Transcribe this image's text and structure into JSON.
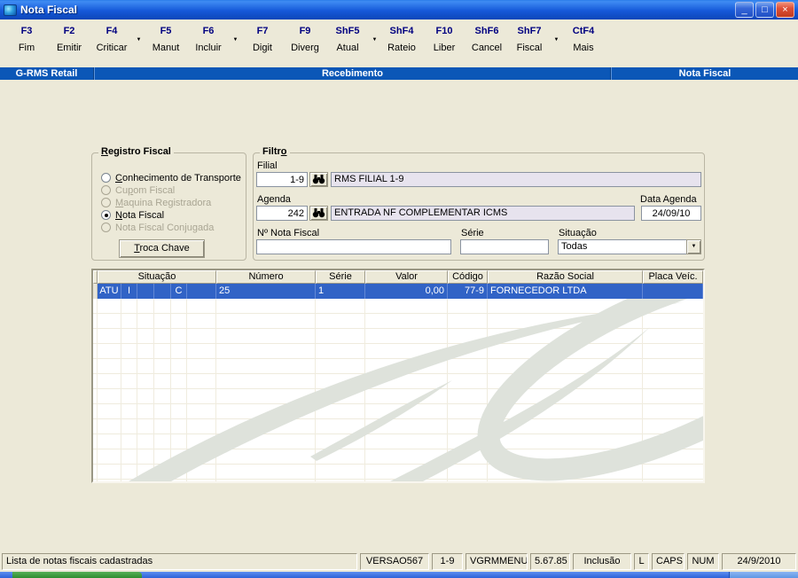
{
  "window": {
    "title": "Nota Fiscal"
  },
  "window_controls": {
    "minimize": "_",
    "restore": "□",
    "close": "×"
  },
  "icons": {
    "dropdown_arrow": "▼"
  },
  "colors": {
    "banner_blue": "#0B57B7",
    "selection_blue": "#3163C6",
    "toolbar_key_navy": "#000080",
    "readonly_field_lavender": "#E7E3EE",
    "watermark_gray": "#DEE2DB",
    "desktop_beige": "#ECE9D8"
  },
  "toolbar": {
    "buttons": [
      {
        "key": "F3",
        "label": "Fim"
      },
      {
        "key": "F2",
        "label": "Emitir"
      },
      {
        "key": "F4",
        "label": "Criticar"
      },
      {
        "key": "F5",
        "label": "Manut"
      },
      {
        "key": "F6",
        "label": "Incluir"
      },
      {
        "key": "F7",
        "label": "Digit"
      },
      {
        "key": "F9",
        "label": "Diverg"
      },
      {
        "key": "ShF5",
        "label": "Atual"
      },
      {
        "key": "ShF4",
        "label": "Rateio"
      },
      {
        "key": "F10",
        "label": "Liber"
      },
      {
        "key": "ShF6",
        "label": "Cancel"
      },
      {
        "key": "ShF7",
        "label": "Fiscal"
      },
      {
        "key": "CtF4",
        "label": "Mais"
      }
    ]
  },
  "banner": {
    "left": "G-RMS Retail",
    "center": "Recebimento",
    "right": "Nota Fiscal"
  },
  "registro": {
    "title": "&Registro Fiscal",
    "options": [
      {
        "label": "&Conhecimento de Transporte",
        "selected": false,
        "disabled": false
      },
      {
        "label": "Cu&pom Fiscal",
        "selected": false,
        "disabled": true
      },
      {
        "label": "&Maquina Registradora",
        "selected": false,
        "disabled": true
      },
      {
        "label": "&Nota Fiscal",
        "selected": true,
        "disabled": false
      },
      {
        "label": "Nota Fiscal Con&jugada",
        "selected": false,
        "disabled": true
      }
    ],
    "button_label": "&Troca Chave"
  },
  "filtro": {
    "title": "Filtr&o",
    "filial": {
      "label": "Filial",
      "code": "1-9",
      "name": "RMS FILIAL 1-9"
    },
    "agenda": {
      "label": "Agenda",
      "code": "242",
      "name": "ENTRADA NF COMPLEMENTAR ICMS"
    },
    "data_agenda": {
      "label": "Data Agenda",
      "value": "24/09/10"
    },
    "nota_fiscal": {
      "label": "Nº Nota Fiscal",
      "value": ""
    },
    "serie": {
      "label": "Série",
      "value": ""
    },
    "situacao": {
      "label": "Situação",
      "value": "Todas"
    }
  },
  "table": {
    "group_header": "Situação",
    "headers": [
      "Número",
      "Série",
      "Valor",
      "Código",
      "Razão Social",
      "Placa Veíc."
    ],
    "row": {
      "situacao": [
        "ATU",
        "I",
        "",
        "",
        "C",
        ""
      ],
      "numero": "25",
      "serie": "1",
      "valor": "0,00",
      "codigo": "77-9",
      "razao_social": "FORNECEDOR LTDA",
      "placa": ""
    }
  },
  "statusbar": {
    "message": "Lista de notas fiscais cadastradas",
    "segments": [
      "VERSAO567",
      "1-9",
      "VGRMMENU",
      "5.67.85",
      "Inclusão",
      "L",
      "CAPS",
      "NUM",
      "24/9/2010"
    ]
  }
}
